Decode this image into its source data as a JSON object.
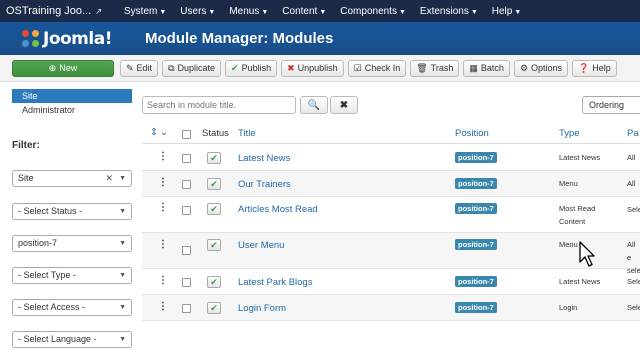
{
  "topbar": {
    "site_name": "OSTraining Joo...",
    "menu": [
      "System",
      "Users",
      "Menus",
      "Content",
      "Components",
      "Extensions",
      "Help"
    ]
  },
  "header": {
    "logo_text": "Joomla!",
    "page_title": "Module Manager: Modules"
  },
  "toolbar": {
    "buttons": [
      {
        "label": "New",
        "icon": "plus-circle-icon"
      },
      {
        "label": "Edit",
        "icon": "edit-icon"
      },
      {
        "label": "Duplicate",
        "icon": "copy-icon"
      },
      {
        "label": "Publish",
        "icon": "check-icon"
      },
      {
        "label": "Unpublish",
        "icon": "x-circle-icon"
      },
      {
        "label": "Check In",
        "icon": "checkbox-icon"
      },
      {
        "label": "Trash",
        "icon": "trash-icon"
      },
      {
        "label": "Batch",
        "icon": "batch-icon"
      },
      {
        "label": "Options",
        "icon": "gear-icon"
      },
      {
        "label": "Help",
        "icon": "question-icon"
      }
    ]
  },
  "sidebar": {
    "items": [
      {
        "label": "Site",
        "active": true
      },
      {
        "label": "Administrator",
        "active": false
      }
    ],
    "filter_label": "Filter:",
    "filters": [
      "Site",
      "- Select Status -",
      "position-7",
      "- Select Type -",
      "- Select Access -",
      "- Select Language -"
    ]
  },
  "search": {
    "placeholder": "Search in module title.",
    "ordering": "Ordering"
  },
  "table": {
    "columns": {
      "status": "Status",
      "title": "Title",
      "position": "Position",
      "type": "Type",
      "pages": "Pa"
    },
    "rows": [
      {
        "title": "Latest News",
        "position": "position-7",
        "type": "Latest News",
        "pages": "All"
      },
      {
        "title": "Our Trainers",
        "position": "position-7",
        "type": "Menu",
        "pages": "All"
      },
      {
        "title": "Articles Most Read",
        "position": "position-7",
        "type": "Most Read Content",
        "pages": "Sele"
      },
      {
        "title": "User Menu",
        "position": "position-7",
        "type": "Menu",
        "pages": "All e\nsele"
      },
      {
        "title": "Latest Park Blogs",
        "position": "position-7",
        "type": "Latest News",
        "pages": "Sele"
      },
      {
        "title": "Login Form",
        "position": "position-7",
        "type": "Login",
        "pages": "Sele"
      }
    ]
  },
  "colors": {
    "topbar": "#1b2a47",
    "header": "#1a5496",
    "accent": "#2d7bbd",
    "new_button": "#46994a",
    "position_badge": "#3a87ad"
  }
}
